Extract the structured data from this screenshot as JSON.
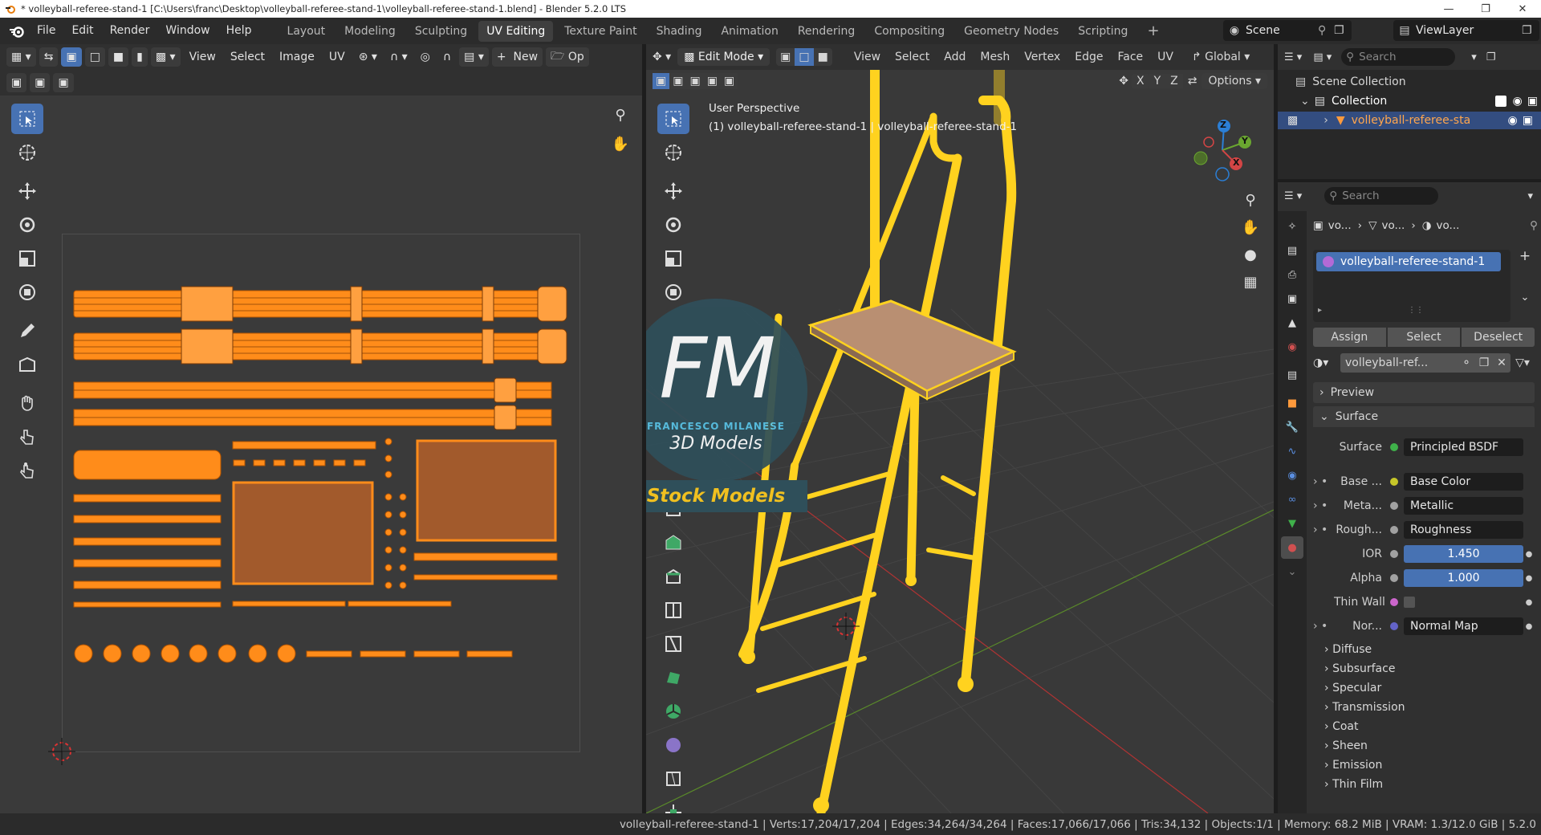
{
  "titlebar": {
    "title": "* volleyball-referee-stand-1 [C:\\Users\\franc\\Desktop\\volleyball-referee-stand-1\\volleyball-referee-stand-1.blend] - Blender 5.2.0 LTS"
  },
  "menu": {
    "file": "File",
    "edit": "Edit",
    "render": "Render",
    "window": "Window",
    "help": "Help"
  },
  "workspaces": [
    "Layout",
    "Modeling",
    "Sculpting",
    "UV Editing",
    "Texture Paint",
    "Shading",
    "Animation",
    "Rendering",
    "Compositing",
    "Geometry Nodes",
    "Scripting"
  ],
  "active_workspace": "UV Editing",
  "scene": {
    "name": "Scene",
    "view_layer": "ViewLayer"
  },
  "uv_editor": {
    "menus": {
      "view": "View",
      "select": "Select",
      "image": "Image",
      "uv": "UV"
    },
    "new_label": "New",
    "open_label": "Op"
  },
  "viewport": {
    "mode": "Edit Mode",
    "menus": {
      "view": "View",
      "select": "Select",
      "add": "Add",
      "mesh": "Mesh",
      "vertex": "Vertex",
      "edge": "Edge",
      "face": "Face",
      "uv": "UV"
    },
    "orientation": "Global",
    "options": "Options",
    "axes_lock": {
      "x": "X",
      "y": "Y",
      "z": "Z"
    },
    "perspective": "User Perspective",
    "object_info": "(1) volleyball-referee-stand-1 | volleyball-referee-stand-1",
    "gizmo": {
      "z": "Z",
      "y": "Y",
      "x": "X"
    }
  },
  "watermark": {
    "logo_letters": "FM",
    "author": "FRANCESCO MILANESE",
    "subtitle": "3D Models",
    "badge": "Stock Models"
  },
  "outliner": {
    "search_placeholder": "Search",
    "scene_collection": "Scene Collection",
    "collection": "Collection",
    "object": "volleyball-referee-sta"
  },
  "properties": {
    "search_placeholder": "Search",
    "breadcrumb": [
      "vo...",
      "vo...",
      "vo..."
    ],
    "material_slot": "volleyball-referee-stand-1",
    "assign": "Assign",
    "select": "Select",
    "deselect": "Deselect",
    "material_name": "volleyball-ref...",
    "preview": "Preview",
    "surface_section": "Surface",
    "rows": [
      {
        "label": "Surface",
        "value": "Principled BSDF",
        "dot": "#3fb14a"
      },
      {
        "label": "Base ...",
        "value": "Base Color",
        "dot": "#c7c729"
      },
      {
        "label": "Meta...",
        "value": "Metallic",
        "dot": "#a1a1a1"
      },
      {
        "label": "Rough...",
        "value": "Roughness",
        "dot": "#a1a1a1"
      },
      {
        "label": "IOR",
        "value": "1.450",
        "dot": "#a1a1a1"
      },
      {
        "label": "Alpha",
        "value": "1.000",
        "dot": "#a1a1a1"
      },
      {
        "label": "Thin Wall",
        "value": "",
        "dot": "#cc66cc"
      },
      {
        "label": "Nor...",
        "value": "Normal Map",
        "dot": "#6363c7"
      }
    ],
    "subpanels": [
      "Diffuse",
      "Subsurface",
      "Specular",
      "Transmission",
      "Coat",
      "Sheen",
      "Emission",
      "Thin Film"
    ]
  },
  "status": {
    "object": "volleyball-referee-stand-1",
    "verts": "Verts:17,204/17,204",
    "edges": "Edges:34,264/34,264",
    "faces": "Faces:17,066/17,066",
    "tris": "Tris:34,132",
    "objects": "Objects:1/1",
    "memory": "Memory: 68.2 MiB",
    "vram": "VRAM: 1.3/12.0 GiB",
    "version": "5.2.0"
  },
  "colors": {
    "accent": "#4772b3",
    "uv_orange": "#ff8c1a",
    "mesh_yellow": "#ffd21f"
  }
}
